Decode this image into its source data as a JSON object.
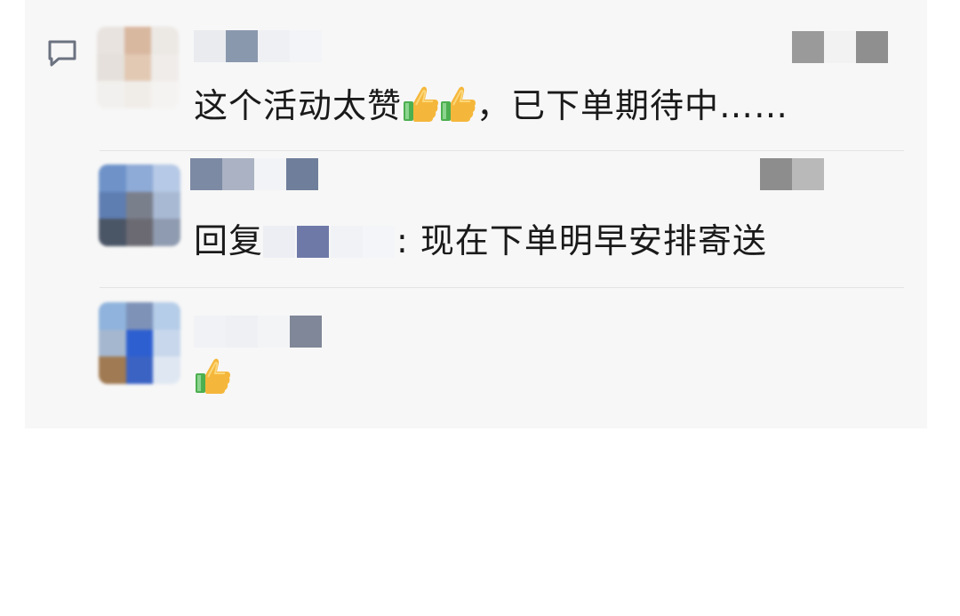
{
  "comments": [
    {
      "text_before": "这个活动太赞",
      "emoji": [
        "thumbs-up",
        "thumbs-up"
      ],
      "text_after": "，已下单期待中……"
    },
    {
      "reply_prefix": "回复",
      "reply_text": "现在下单明早安排寄送"
    },
    {
      "emoji": [
        "thumbs-up"
      ]
    }
  ]
}
